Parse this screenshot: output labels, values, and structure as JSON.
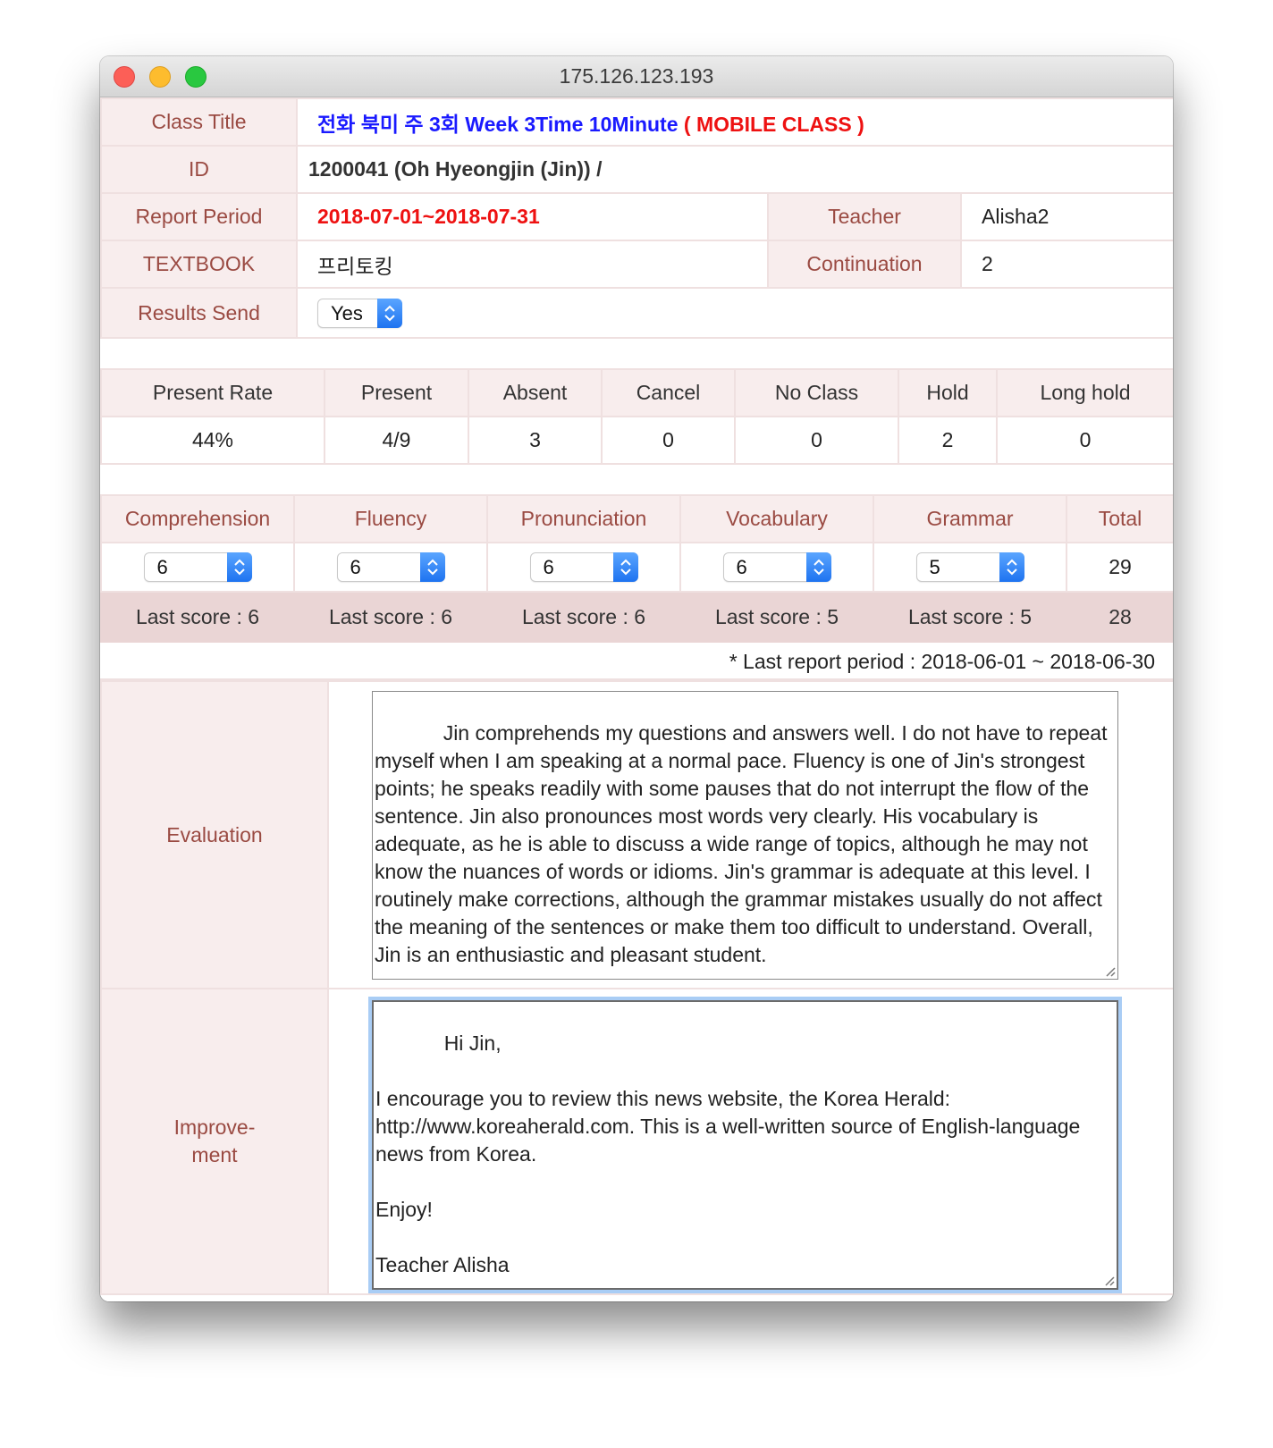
{
  "window": {
    "title": "175.126.123.193"
  },
  "info": {
    "class_title_label": "Class Title",
    "class_title_blue": "전화 북미 주 3회 Week 3Time 10Minute",
    "class_title_red": "( MOBILE CLASS )",
    "id_label": "ID",
    "id_value": "1200041 (Oh Hyeongjin (Jin)) /",
    "period_label": "Report Period",
    "period_value": "2018-07-01~2018-07-31",
    "teacher_label": "Teacher",
    "teacher_value": "Alisha2",
    "textbook_label": "TEXTBOOK",
    "textbook_value": "프리토킹",
    "continuation_label": "Continuation",
    "continuation_value": "2",
    "results_label": "Results Send",
    "results_value": "Yes"
  },
  "attendance": {
    "headers": [
      "Present Rate",
      "Present",
      "Absent",
      "Cancel",
      "No Class",
      "Hold",
      "Long hold"
    ],
    "values": [
      "44%",
      "4/9",
      "3",
      "0",
      "0",
      "2",
      "0"
    ]
  },
  "scores": {
    "headers": [
      "Comprehension",
      "Fluency",
      "Pronunciation",
      "Vocabulary",
      "Grammar",
      "Total"
    ],
    "current": [
      "6",
      "6",
      "6",
      "6",
      "5"
    ],
    "total": "29",
    "last": [
      "Last score : 6",
      "Last score : 6",
      "Last score : 6",
      "Last score : 5",
      "Last score : 5"
    ],
    "last_total": "28",
    "footnote": "* Last report period : 2018-06-01 ~ 2018-06-30"
  },
  "evaluation": {
    "label": "Evaluation",
    "text": "Jin comprehends my questions and answers well. I do not have to repeat myself when I am speaking at a normal pace. Fluency is one of Jin's strongest points; he speaks readily with some pauses that do not interrupt the flow of the sentence. Jin also pronounces most words very clearly. His vocabulary is adequate, as he is able to discuss a wide range of topics, although he may not know the nuances of words or idioms. Jin's grammar is adequate at this level. I routinely make corrections, although the grammar mistakes usually do not affect the meaning of the sentences or make them too difficult to understand. Overall, Jin is an enthusiastic and pleasant student."
  },
  "improvement": {
    "label_line1": "Improve-",
    "label_line2": "ment",
    "text": "Hi Jin,\n\nI encourage you to review this news website, the Korea Herald: http://www.koreaherald.com. This is a well-written source of English-language news from Korea.\n\nEnjoy!\n\nTeacher Alisha"
  },
  "colors": {
    "label_bg": "#f8eded",
    "label_text": "#9a4a42",
    "border": "#efe0e0",
    "last_row_bg": "#ead5d5",
    "blue": "#1a1aff",
    "red": "#ee1111",
    "focus_ring": "#a9cdf5"
  },
  "icons": {
    "select_stepper": "up-down-chevron-icon",
    "resize_grip": "resize-grip-icon"
  }
}
